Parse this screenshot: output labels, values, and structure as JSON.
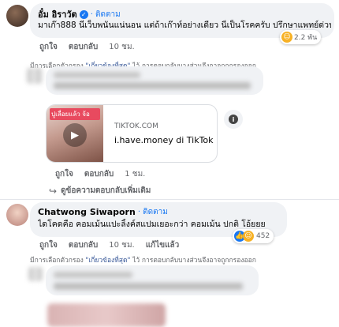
{
  "comment1": {
    "author": "อั๋ม อิราวัต",
    "verified": true,
    "follow_label": "· ติดตาม",
    "text": "มาเก๊า888 นี่เว็บพนันแน่นอน แต่ถ้าเก๊าท์อย่างเดียว นี่เป็นโรคครับ ปรึกษาแพทย์ด่วน",
    "like_label": "ถูกใจ",
    "reply_label": "ตอบกลับ",
    "time": "10 ชม.",
    "reaction_count": "2.2 พัน",
    "filter_note_prefix": "มีการเลือกตัวกรอง ",
    "filter_note_quote": "\"เกี่ยวข้องที่สุด\"",
    "filter_note_suffix": " ไว้ การตอบกลับบางส่วนจึงอาจถูกกรองออก"
  },
  "reply1": {
    "link_preview": {
      "domain": "TIKTOK.COM",
      "title": "i.have.money di TikTok",
      "thumbnail_caption": "ปูเลื่อยแล้ว จ้อ"
    },
    "like_label": "ถูกใจ",
    "reply_label": "ตอบกลับ",
    "time": "1 ชม."
  },
  "more_replies_label": "ดูข้อความตอบกลับเพิ่มเติม",
  "comment2": {
    "author": "Chatwong Siwaporn",
    "follow_label": "· ติดตาม",
    "text": "ไดโคดคือ คอมเม้นแปะลิ้งค์สแปมเยอะกว่า คอมเม้น ปกติ โอ้ยยย",
    "like_label": "ถูกใจ",
    "reply_label": "ตอบกลับ",
    "time": "10 ชม.",
    "edited_label": "แก้ไขแล้ว",
    "reaction_count": "452",
    "filter_note_prefix": "มีการเลือกตัวกรอง ",
    "filter_note_quote": "\"เกี่ยวข้องที่สุด\"",
    "filter_note_suffix": " ไว้ การตอบกลับบางส่วนจึงอาจถูกกรองออก"
  },
  "colors": {
    "accent": "#1877f2",
    "bubble": "#f0f2f5",
    "muted": "#65676b"
  }
}
